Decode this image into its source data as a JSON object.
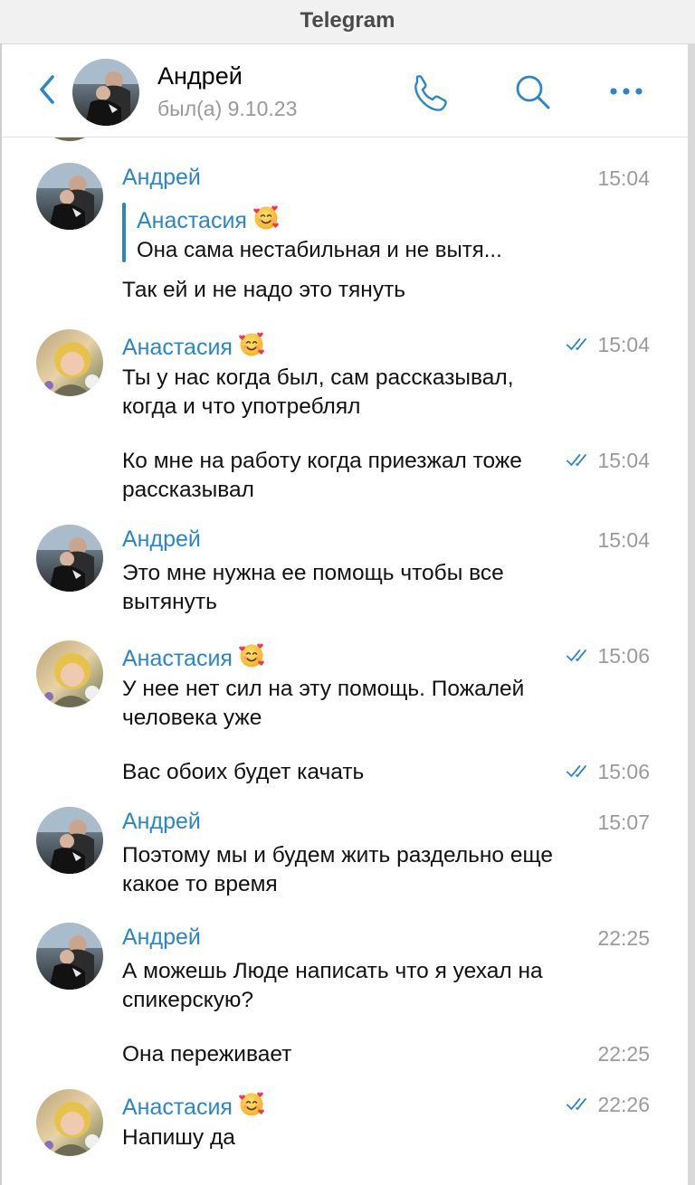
{
  "window": {
    "title": "Telegram"
  },
  "header": {
    "contact_name": "Андрей",
    "status": "был(а) 9.10.23"
  },
  "icons": {
    "back": "chevron-left-icon",
    "call": "phone-icon",
    "search": "search-icon",
    "more": "more-dots-icon",
    "read": "double-check-icon",
    "reaction_emoji": "smiling-face-with-hearts-icon"
  },
  "colors": {
    "accent": "#2a86c9",
    "time": "#9a9a9a",
    "status": "#999999"
  },
  "messages": [
    {
      "sender": "Андрей",
      "time": "15:04",
      "reply_to": {
        "sender": "Анастасия",
        "text": "Она сама нестабильная и не вытя..."
      },
      "text": "Так ей и не надо это тянуть"
    },
    {
      "sender": "Анастасия",
      "time": "15:04",
      "read": true,
      "text": "Ты у нас когда был, сам рассказывал, когда и что употреблял"
    },
    {
      "time": "15:04",
      "read": true,
      "text": "Ко мне на работу когда приезжал тоже рассказывал"
    },
    {
      "sender": "Андрей",
      "time": "15:04",
      "text": "Это мне нужна ее помощь чтобы все вытянуть"
    },
    {
      "sender": "Анастасия",
      "time": "15:06",
      "read": true,
      "text": "У нее нет сил на эту помощь. Пожалей человека уже"
    },
    {
      "time": "15:06",
      "read": true,
      "text": "Вас обоих будет качать"
    },
    {
      "sender": "Андрей",
      "time": "15:07",
      "text": "Поэтому мы и будем жить раздельно еще какое то время"
    },
    {
      "sender": "Андрей",
      "time": "22:25",
      "text": "А можешь Люде написать что я уехал на спикерскую?"
    },
    {
      "time": "22:25",
      "text": "Она переживает"
    },
    {
      "sender": "Анастасия",
      "time": "22:26",
      "read": true,
      "text": "Напишу да"
    }
  ]
}
